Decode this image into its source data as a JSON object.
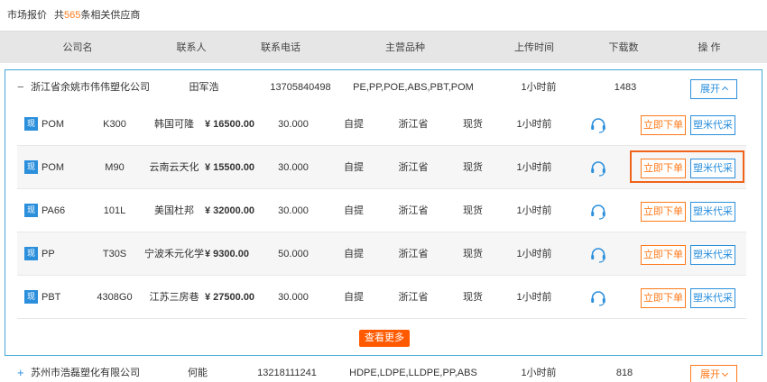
{
  "header": {
    "title": "市场报价",
    "count_prefix": "共",
    "count": "565",
    "count_suffix": "条相关供应商"
  },
  "columns": {
    "company": "公司名",
    "contact": "联系人",
    "phone": "联系电话",
    "products": "主营品种",
    "upload_time": "上传时间",
    "downloads": "下载数",
    "actions": "操 作"
  },
  "companies": [
    {
      "toggle": "−",
      "name": "浙江省余姚市伟伟塑化公司",
      "contact": "田军浩",
      "phone": "13705840498",
      "products": "PE,PP,POE,ABS,PBT,POM",
      "upload_time": "1小时前",
      "downloads": "1483",
      "expand_label": "展开",
      "items": [
        {
          "badge": "现",
          "grade": "POM",
          "model": "K300",
          "brand": "韩国可隆",
          "price": "¥ 16500.00",
          "qty": "30.000",
          "delivery": "自提",
          "region": "浙江省",
          "stock": "现货",
          "time": "1小时前",
          "order_label": "立即下单",
          "buy_label": "塑米代采"
        },
        {
          "badge": "现",
          "grade": "POM",
          "model": "M90",
          "brand": "云南云天化",
          "price": "¥ 15500.00",
          "qty": "30.000",
          "delivery": "自提",
          "region": "浙江省",
          "stock": "现货",
          "time": "1小时前",
          "order_label": "立即下单",
          "buy_label": "塑米代采"
        },
        {
          "badge": "现",
          "grade": "PA66",
          "model": "101L",
          "brand": "美国杜邦",
          "price": "¥ 32000.00",
          "qty": "30.000",
          "delivery": "自提",
          "region": "浙江省",
          "stock": "现货",
          "time": "1小时前",
          "order_label": "立即下单",
          "buy_label": "塑米代采"
        },
        {
          "badge": "现",
          "grade": "PP",
          "model": "T30S",
          "brand": "宁波禾元化学",
          "price": "¥ 9300.00",
          "qty": "50.000",
          "delivery": "自提",
          "region": "浙江省",
          "stock": "现货",
          "time": "1小时前",
          "order_label": "立即下单",
          "buy_label": "塑米代采"
        },
        {
          "badge": "现",
          "grade": "PBT",
          "model": "4308G0",
          "brand": "江苏三房巷",
          "price": "¥ 27500.00",
          "qty": "30.000",
          "delivery": "自提",
          "region": "浙江省",
          "stock": "现货",
          "time": "1小时前",
          "order_label": "立即下单",
          "buy_label": "塑米代采"
        }
      ],
      "more_label": "查看更多"
    },
    {
      "toggle": "+",
      "name": "苏州市浩磊塑化有限公司",
      "contact": "何能",
      "phone": "13218111241",
      "products": "HDPE,LDPE,LLDPE,PP,ABS",
      "upload_time": "1小时前",
      "downloads": "818",
      "expand_label": "展开"
    }
  ],
  "colors": {
    "accent_blue": "#2b8fdc",
    "accent_orange": "#ff7a1a",
    "price_red": "#ff5a00",
    "highlight": "#f0631a"
  }
}
